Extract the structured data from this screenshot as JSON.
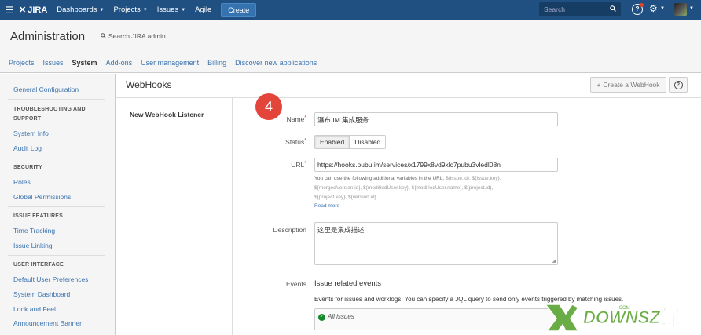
{
  "topnav": {
    "brand": "JIRA",
    "items": [
      {
        "label": "Dashboards",
        "has_caret": true
      },
      {
        "label": "Projects",
        "has_caret": true
      },
      {
        "label": "Issues",
        "has_caret": true
      },
      {
        "label": "Agile",
        "has_caret": false
      }
    ],
    "create_label": "Create",
    "search_placeholder": "Search",
    "colors": {
      "bar": "#205081",
      "create": "#3572b0"
    }
  },
  "admin": {
    "title": "Administration",
    "search_label": "Search JIRA admin"
  },
  "tabs": [
    {
      "label": "Projects",
      "active": false
    },
    {
      "label": "Issues",
      "active": false
    },
    {
      "label": "System",
      "active": true
    },
    {
      "label": "Add-ons",
      "active": false
    },
    {
      "label": "User management",
      "active": false
    },
    {
      "label": "Billing",
      "active": false
    },
    {
      "label": "Discover new applications",
      "active": false
    }
  ],
  "sidebar": {
    "general": "General Configuration",
    "troubleshooting_heading_1": "TROUBLESHOOTING AND",
    "troubleshooting_heading_2": "SUPPORT",
    "system_info": "System Info",
    "audit_log": "Audit Log",
    "security_heading": "SECURITY",
    "roles": "Roles",
    "global_permissions": "Global Permissions",
    "issue_features_heading": "ISSUE FEATURES",
    "time_tracking": "Time Tracking",
    "issue_linking": "Issue Linking",
    "user_interface_heading": "USER INTERFACE",
    "default_user_prefs": "Default User Preferences",
    "system_dashboard": "System Dashboard",
    "look_and_feel": "Look and Feel",
    "announcement_banner": "Announcement Banner"
  },
  "page": {
    "title": "WebHooks",
    "create_button": "Create a WebHook",
    "listener_label": "New WebHook Listener",
    "step_number": "4"
  },
  "form": {
    "name_label": "Name",
    "name_value": "瀑布 IM 集成服务",
    "status_label": "Status",
    "status_enabled": "Enabled",
    "status_disabled": "Disabled",
    "url_label": "URL",
    "url_value": "https://hooks.pubu.im/services/x1799x8vd9xlc7pubu3vledl08n",
    "url_help_lead": "You can use the following additional variables in the URL:",
    "url_help_vars_1": "${issue.id}, ${issue.key},",
    "url_help_vars_2": "${mergedVersion.id}, ${modifiedUser.key}, ${modifiedUser.name}, ${project.id},",
    "url_help_vars_3": "${project.key}, ${version.id}",
    "read_more": "Read more",
    "description_label": "Description",
    "description_value": "这里是集成描述",
    "events_label": "Events",
    "events_heading": "Issue related events",
    "events_desc": "Events for issues and worklogs. You can specify a JQL query to send only events triggered by matching issues.",
    "jql_value": "All issues"
  }
}
